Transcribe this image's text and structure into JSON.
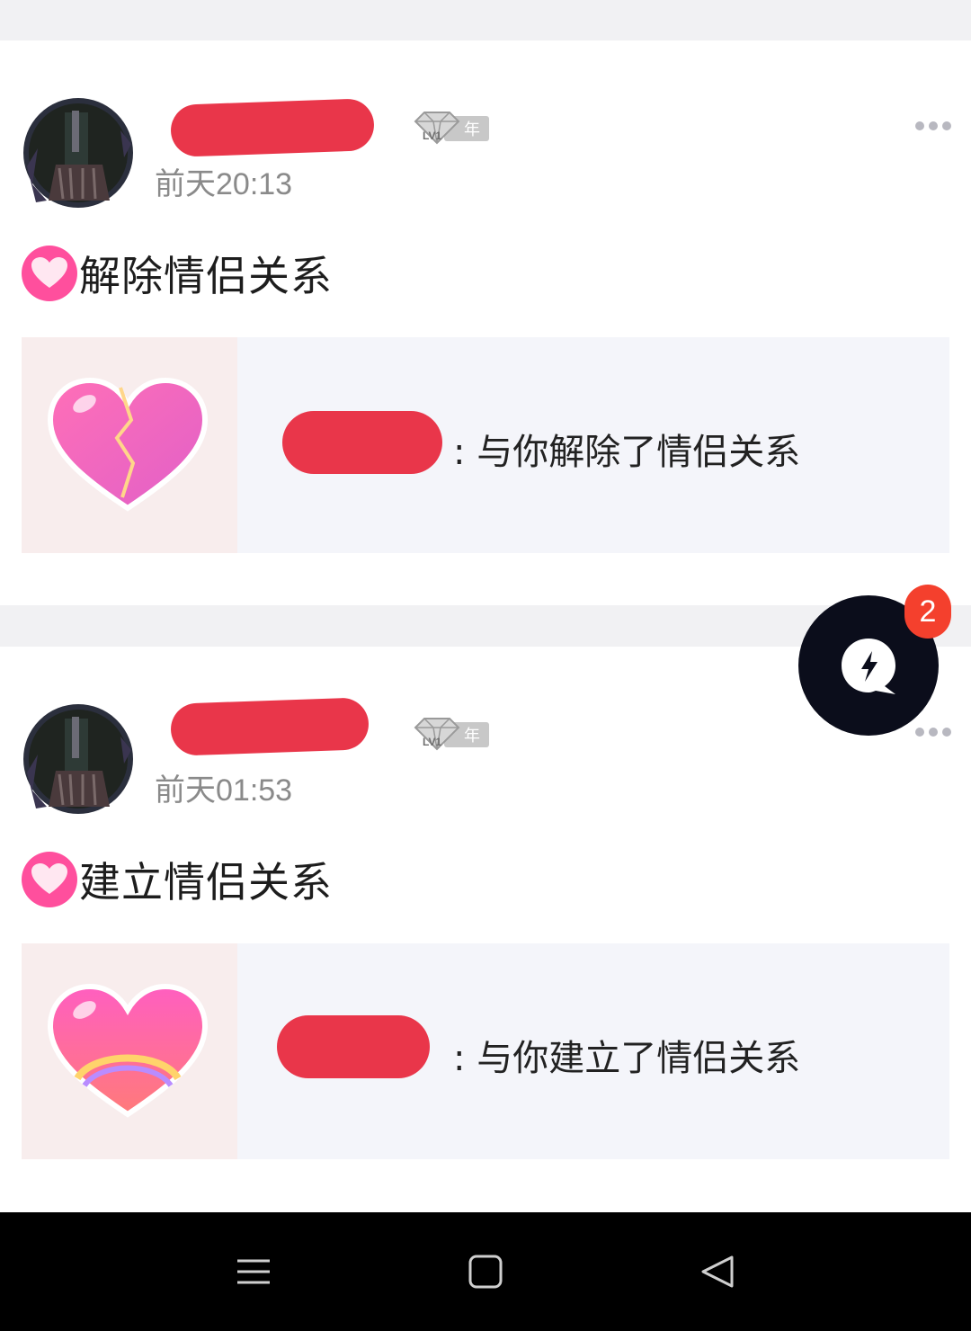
{
  "posts": [
    {
      "time": "前天20:13",
      "level_badge": {
        "level": "LV1",
        "suffix": "年"
      },
      "title": "解除情侣关系",
      "content_text": ": 与你解除了情侣关系",
      "thumb_icon": "broken-heart-icon"
    },
    {
      "time": "前天01:53",
      "level_badge": {
        "level": "LV1",
        "suffix": "年"
      },
      "title": "建立情侣关系",
      "content_text": ": 与你建立了情侣关系",
      "thumb_icon": "rainbow-heart-icon"
    }
  ],
  "fab": {
    "icon": "lightning-chat-icon",
    "badge_count": "2"
  },
  "navbar": {
    "buttons": [
      "menu-icon",
      "home-square-icon",
      "back-triangle-icon"
    ]
  },
  "colors": {
    "accent_pink": "#ff4f9d",
    "redaction": "#e9364a",
    "badge_red": "#f4402d",
    "fab_bg": "#0b0d1b"
  }
}
